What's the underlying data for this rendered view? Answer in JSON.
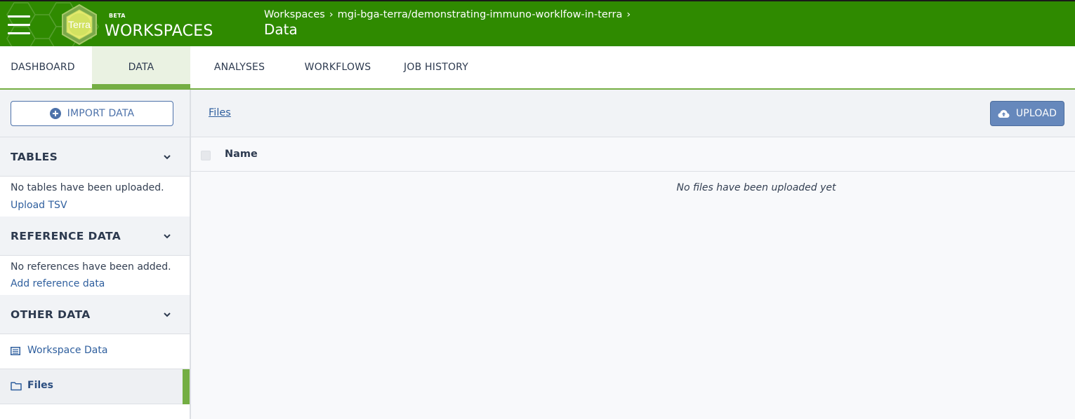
{
  "header": {
    "menu_icon": "hamburger-icon",
    "logo_text": "Terra",
    "beta_label": "BETA",
    "app_title": "WORKSPACES",
    "breadcrumb": {
      "root": "Workspaces",
      "workspace": "mgi-bga-terra/demonstrating-immuno-worklfow-in-terra",
      "separator": "›"
    },
    "page_title": "Data",
    "colors": {
      "background": "#2f8a00",
      "accent": "#74ae43"
    }
  },
  "tabs": [
    {
      "label": "DASHBOARD",
      "active": false
    },
    {
      "label": "DATA",
      "active": true
    },
    {
      "label": "ANALYSES",
      "active": false
    },
    {
      "label": "WORKFLOWS",
      "active": false
    },
    {
      "label": "JOB HISTORY",
      "active": false
    }
  ],
  "sidebar": {
    "import_button": {
      "label": "IMPORT DATA",
      "icon": "plus-circle-icon"
    },
    "sections": {
      "tables": {
        "title": "TABLES",
        "empty_text": "No tables have been uploaded.",
        "action": "Upload TSV",
        "icon": "chevron-down-icon"
      },
      "reference": {
        "title": "REFERENCE DATA",
        "empty_text": "No references have been added.",
        "action": "Add reference data",
        "icon": "chevron-down-icon"
      },
      "other": {
        "title": "OTHER DATA",
        "icon": "chevron-down-icon",
        "items": [
          {
            "label": "Workspace Data",
            "icon": "list-icon",
            "selected": false
          },
          {
            "label": "Files",
            "icon": "folder-icon",
            "selected": true
          }
        ]
      }
    }
  },
  "main": {
    "breadcrumb_link": "Files",
    "upload_button": {
      "label": "UPLOAD",
      "icon": "cloud-upload-icon"
    },
    "table": {
      "columns": [
        "Name"
      ],
      "empty_text": "No files have been uploaded yet"
    }
  }
}
